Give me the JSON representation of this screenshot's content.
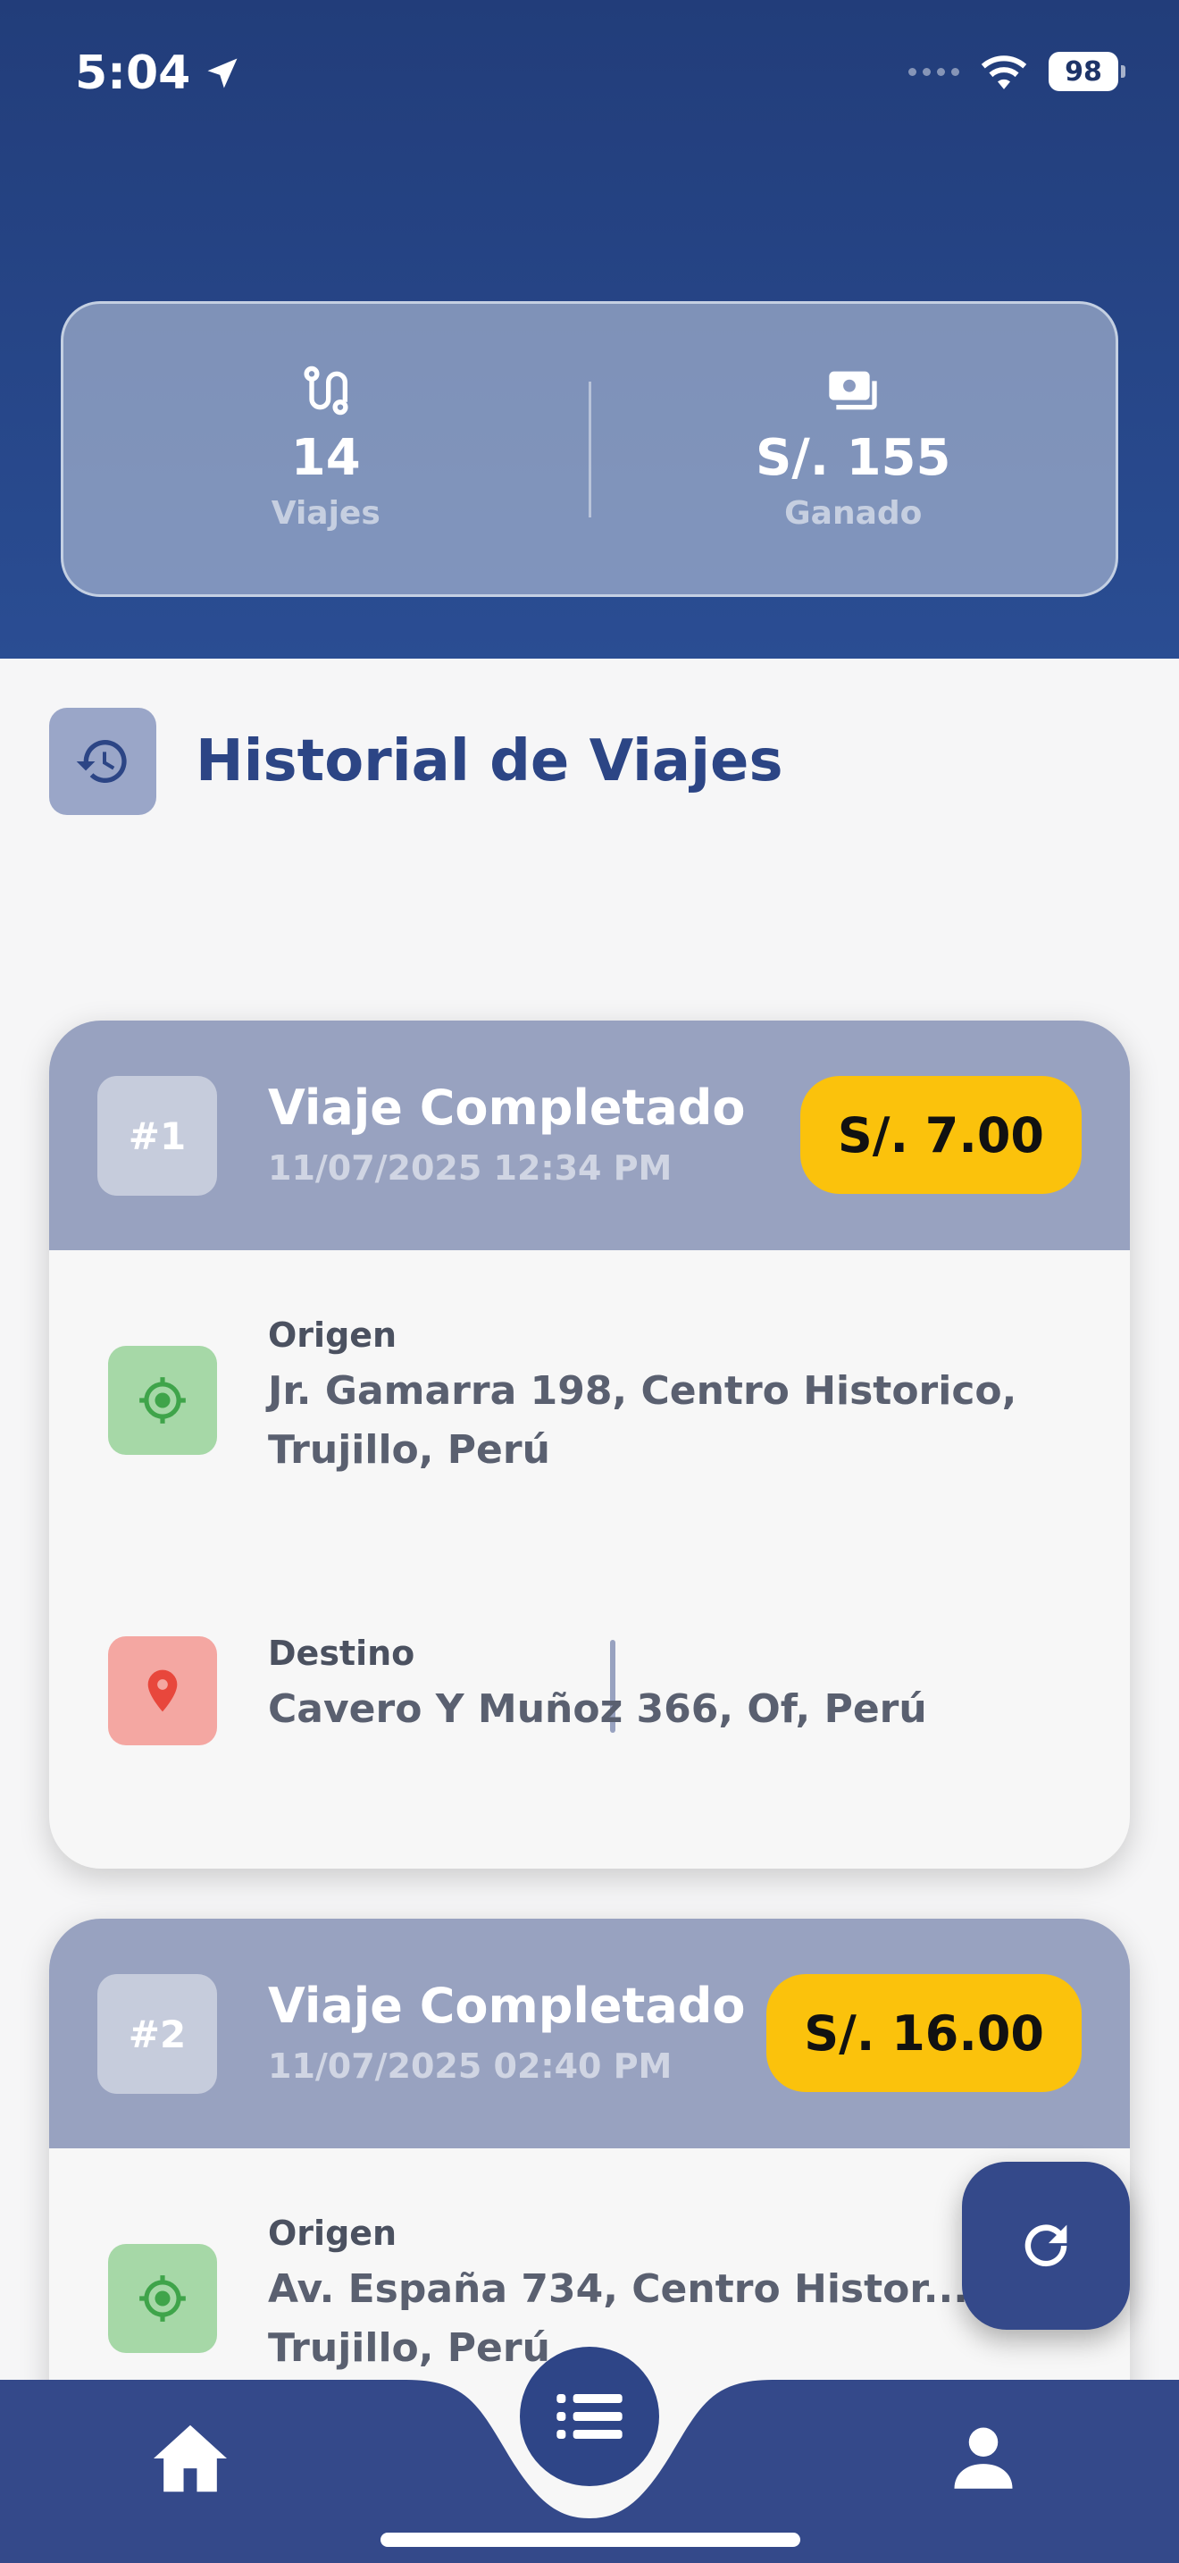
{
  "status_bar": {
    "time": "5:04",
    "battery": "98"
  },
  "stats": {
    "trips_value": "14",
    "trips_label": "Viajes",
    "earned_value": "S/. 155",
    "earned_label": "Ganado"
  },
  "section": {
    "title": "Historial de Viajes"
  },
  "trips": [
    {
      "number": "#1",
      "title": "Viaje Completado",
      "date": "11/07/2025 12:34 PM",
      "price": "S/. 7.00",
      "origin_label": "Origen",
      "origin_address": "Jr. Gamarra 198, Centro Historico, Trujillo, Perú",
      "destination_label": "Destino",
      "destination_address": "Cavero Y Muñoz 366, Of, Perú"
    },
    {
      "number": "#2",
      "title": "Viaje Completado",
      "date": "11/07/2025 02:40 PM",
      "price": "S/. 16.00",
      "origin_label": "Origen",
      "origin_address": "Av. España 734, Centro Histor... Trujillo, Perú"
    }
  ],
  "tabbar": {
    "items": [
      "home-icon",
      "list-icon",
      "person-icon"
    ],
    "colors": {
      "bar": "#34498a",
      "accent": "#fbc20c"
    }
  }
}
